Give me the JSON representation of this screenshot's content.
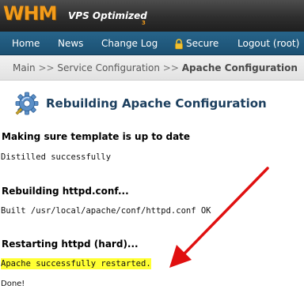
{
  "header": {
    "logo_main": "WHM",
    "logo_sub": "VPS Optimized",
    "logo_version": "3"
  },
  "nav": {
    "home": "Home",
    "news": "News",
    "changelog": "Change Log",
    "secure": "Secure",
    "logout": "Logout (root)"
  },
  "breadcrumb": {
    "main": "Main",
    "separator": ">>",
    "section": "Service Configuration",
    "current": "Apache Configuration"
  },
  "page": {
    "title": "Rebuilding Apache Configuration"
  },
  "steps": [
    {
      "heading": "Making sure template is up to date",
      "output": "Distilled successfully"
    },
    {
      "heading": "Rebuilding httpd.conf...",
      "output": "Built /usr/local/apache/conf/httpd.conf OK"
    },
    {
      "heading": "Restarting httpd (hard)...",
      "output": "Apache successfully restarted."
    }
  ],
  "done": "Done!",
  "colors": {
    "logo_orange": "#f39c1b",
    "nav_blue": "#1b5072",
    "title_blue": "#1c3f5e",
    "highlight_yellow": "#ffff33",
    "annotation_arrow": "#e01010"
  },
  "icons": {
    "secure": "lock-icon",
    "title": "gear-icon"
  }
}
